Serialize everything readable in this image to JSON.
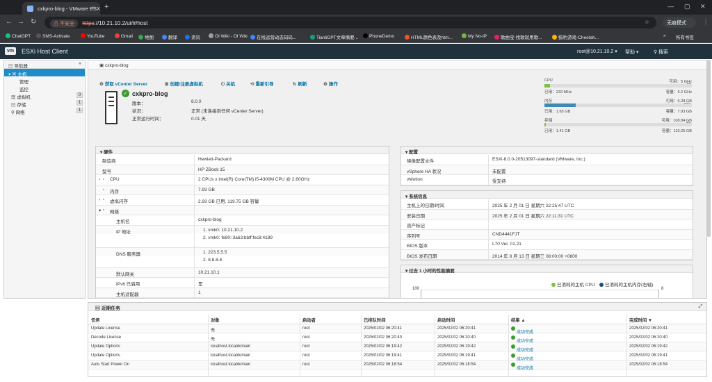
{
  "browser": {
    "tab_title": "cxkpro-blog - VMware ESXi",
    "new_tab": "+",
    "insecure_label": "不安全",
    "url_scheme": "https",
    "url_rest": "://10.21.10.2/ui/#/host",
    "incognito_label": "无痕模式",
    "bookmarks": [
      "ChatGPT",
      "SMS-Activate",
      "YouTube",
      "Gmail",
      "地图",
      "翻译",
      "资讯",
      "OI Wiki - OI Wiki",
      "在线运营动态码码...",
      "TianliGPT文章摘要...",
      "PhoneDemo",
      "HTML颜色表及htm...",
      "My No-IP",
      "歌曲宝-找歌就用歌...",
      "猎豹游戏-Cheetah..."
    ],
    "all_bookmarks": "所有书签",
    "bookmark_colors": [
      "#19c37d",
      "#555",
      "#ff0000",
      "#ea4335",
      "#34a853",
      "#4285f4",
      "#1a73e8",
      "#9aa0a6",
      "#4285f4",
      "#10a37f",
      "#000000",
      "#e8572e",
      "#7cb342",
      "#e91e63",
      "#ffb300"
    ]
  },
  "app": {
    "logo": "vm",
    "title": "ESXi Host Client",
    "user": "root@10.21.10.2",
    "help": "帮助",
    "search": "搜索"
  },
  "navigator": {
    "title": "导航器",
    "host": "主机",
    "manage": "管理",
    "monitor": "监控",
    "items": [
      {
        "label": "虚拟机",
        "count": "0"
      },
      {
        "label": "存储",
        "count": "1"
      },
      {
        "label": "网络",
        "count": "1"
      }
    ]
  },
  "breadcrumb": "cxkpro-blog",
  "actions": {
    "vcenter": "获取 vCenter Server",
    "create_vm": "创建/注册虚拟机",
    "shutdown": "关机",
    "reboot": "重新引导",
    "refresh": "刷新",
    "actions": "操作"
  },
  "summary": {
    "hostname": "cxkpro-blog",
    "version_label": "版本：",
    "version": "8.0.0",
    "state_label": "状况：",
    "state": "正常 (未连接到任何 vCenter Server)",
    "uptime_label": "正常运行时间：",
    "uptime": "0.01 天"
  },
  "resources": [
    {
      "name": "CPU",
      "free_label": "可用：5 GHz",
      "pct": "4%",
      "pct_value": 4,
      "used": "已用：233 MHz",
      "capacity": "容量：5.2 GHz",
      "color": "#7fc241"
    },
    {
      "name": "内存",
      "free_label": "可用：6.28 GB",
      "pct": "21%",
      "pct_value": 21,
      "used": "已用：1.65 GB",
      "capacity": "容量：7.93 GB",
      "color": "#3f89b5"
    },
    {
      "name": "存储",
      "free_label": "可用：108.84 GB",
      "pct": "1%",
      "pct_value": 1,
      "used": "已用：1.41 GB",
      "capacity": "容量：110.25 GB",
      "color": "#7fc241"
    }
  ],
  "hardware": {
    "title": "硬件",
    "rows": [
      {
        "k": "制造商",
        "v": "Hewlett-Packard"
      },
      {
        "k": "型号",
        "v": "HP ZBook 15"
      },
      {
        "k": "CPU",
        "v": "2 CPUs x Intel(R) Core(TM) i5-4300M CPU @ 2.60GHz"
      },
      {
        "k": "内存",
        "v": "7.93 GB"
      },
      {
        "k": "虚拟闪存",
        "v": "2.93 GB 已用, 119.75 GB 容量"
      },
      {
        "k": "网络",
        "v": ""
      },
      {
        "k": "主机名",
        "v": "cxkpro-blog"
      },
      {
        "k": "IP 地址",
        "v": "1. vmk0: 10.21.10.2"
      },
      {
        "k": "",
        "v": "2. vmk0: fe80::3a63:bbff:fec8:4189"
      },
      {
        "k": "DNS 服务器",
        "v": "1. 223.5.5.5"
      },
      {
        "k": "",
        "v": "2. 8.8.8.8"
      },
      {
        "k": "默认网关",
        "v": "10.21.10.1"
      },
      {
        "k": "IPv6 已启用",
        "v": "是"
      },
      {
        "k": "主机适配器",
        "v": "1"
      }
    ]
  },
  "config": {
    "title": "配置",
    "rows": [
      {
        "k": "映像配置文件",
        "v": "ESXi-8.0.0-20513097-standard (VMware, Inc.)"
      },
      {
        "k": "vSphere HA 状况",
        "v": "未配置"
      },
      {
        "k": "vMotion",
        "v": "受支持"
      }
    ]
  },
  "sysinfo": {
    "title": "系统信息",
    "rows": [
      {
        "k": "主机上的日期/时间",
        "v": "2025 年 2 月 01 日 星期六 22:25:47 UTC"
      },
      {
        "k": "安装日期",
        "v": "2025 年 2 月 01 日 星期六 22:11:31 UTC"
      },
      {
        "k": "资产标记",
        "v": ""
      },
      {
        "k": "序列号",
        "v": "CND4441FJT"
      },
      {
        "k": "BIOS 版本",
        "v": "L70 Ver. 01.21"
      },
      {
        "k": "BIOS 发布日期",
        "v": "2014 年 8 月 13 日 星期三 08:00:00 +0800"
      }
    ]
  },
  "perf": {
    "title": "过去 1 小时的性能摘要",
    "legend_cpu": "已消耗的主机 CPU",
    "legend_mem": "已消耗的主机内存(右轴)",
    "y_left_top": "100",
    "y_right_top": "8",
    "cpu_color": "#7fc241",
    "mem_color": "#1f4e79"
  },
  "recent": {
    "title": "近期任务",
    "headers": [
      "任务",
      "对象",
      "启动者",
      "已排队时间",
      "启动时间",
      "结果 ▲",
      "完成时间 ▼"
    ],
    "rows": [
      [
        "Update License",
        "无",
        "root",
        "2025/02/02 06:20:41",
        "2025/02/02 06:20:41",
        "成功完成",
        "2025/02/02 06:20:41"
      ],
      [
        "Decode License",
        "无",
        "root",
        "2025/02/02 06:20:40",
        "2025/02/02 06:20:40",
        "成功完成",
        "2025/02/02 06:20:40"
      ],
      [
        "Update Options",
        "localhost.localdomain",
        "root",
        "2025/02/02 06:19:42",
        "2025/02/02 06:19:42",
        "成功完成",
        "2025/02/02 06:19:42"
      ],
      [
        "Update Options",
        "localhost.localdomain",
        "root",
        "2025/02/02 06:19:41",
        "2025/02/02 06:19:41",
        "成功完成",
        "2025/02/02 06:19:41"
      ],
      [
        "Auto Start Power On",
        "localhost.localdomain",
        "root",
        "2025/02/02 06:18:54",
        "2025/02/02 06:18:54",
        "成功完成",
        "2025/02/02 06:18:54"
      ]
    ]
  }
}
